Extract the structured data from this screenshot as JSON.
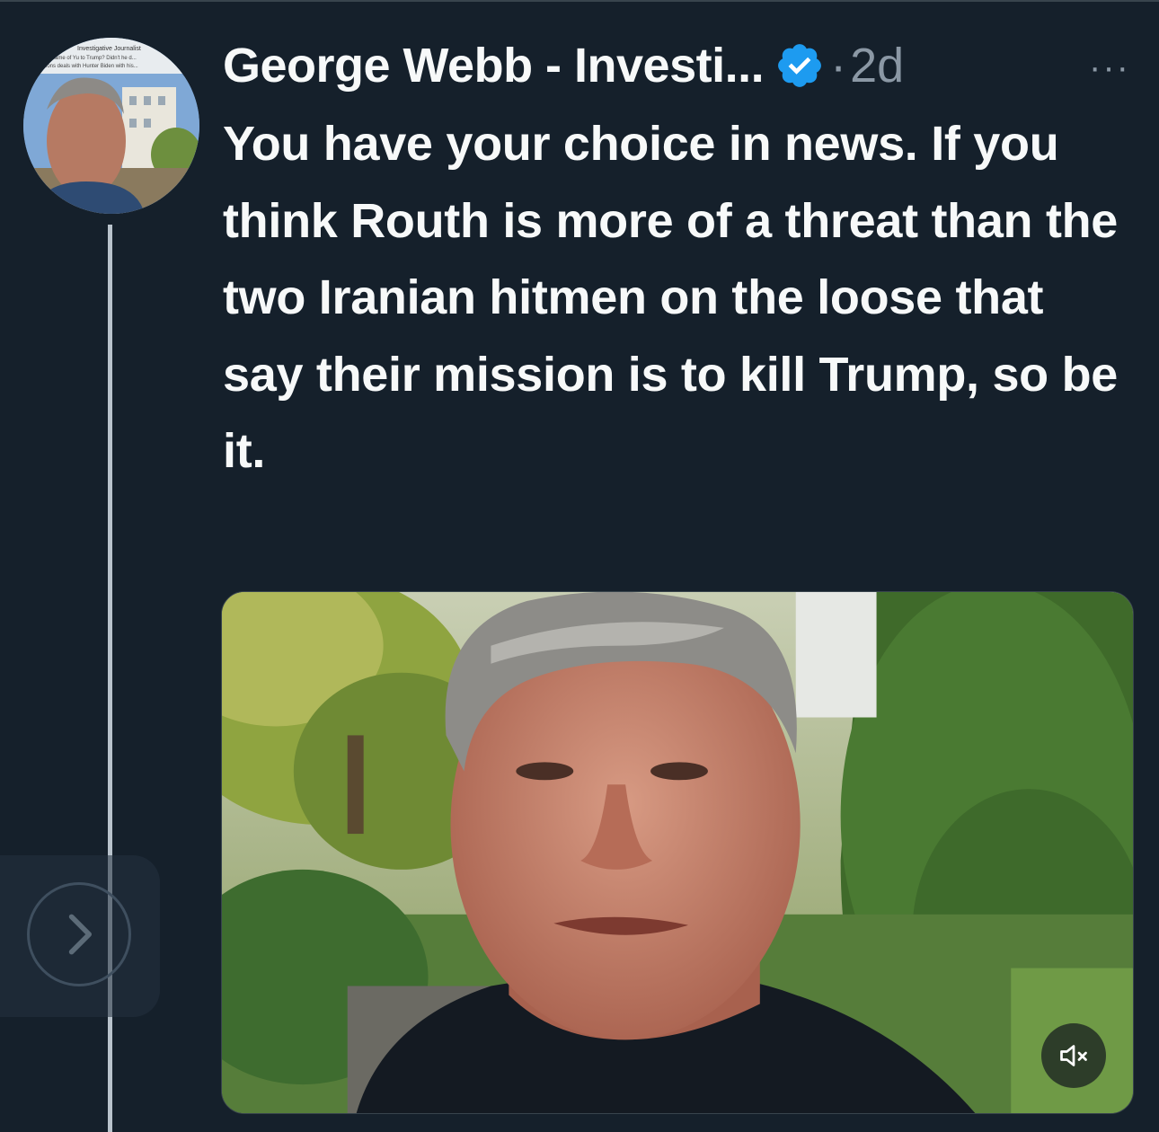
{
  "tweet": {
    "display_name": "George Webb - Investi...",
    "separator": "·",
    "timestamp": "2d",
    "more_label": "···",
    "text": "You have your choice in news. If you think Routh is more of a threat than the two Iranian hitmen on the loose that say their mission is to kill Trump, so be it.",
    "avatar_caption_lines": [
      "Investigative Journalist",
      "...ame of Yu to Trump? Didn't he d...",
      "...ions deals with Hunter Biden with his..."
    ]
  },
  "icons": {
    "verified": "verified-badge-icon",
    "more": "more-icon",
    "mute": "volume-muted-icon",
    "next": "chevron-right-icon"
  },
  "colors": {
    "background": "#15202b",
    "text": "#f7f9f9",
    "secondary_text": "#8b98a5",
    "verified_blue": "#1d9bf0"
  }
}
